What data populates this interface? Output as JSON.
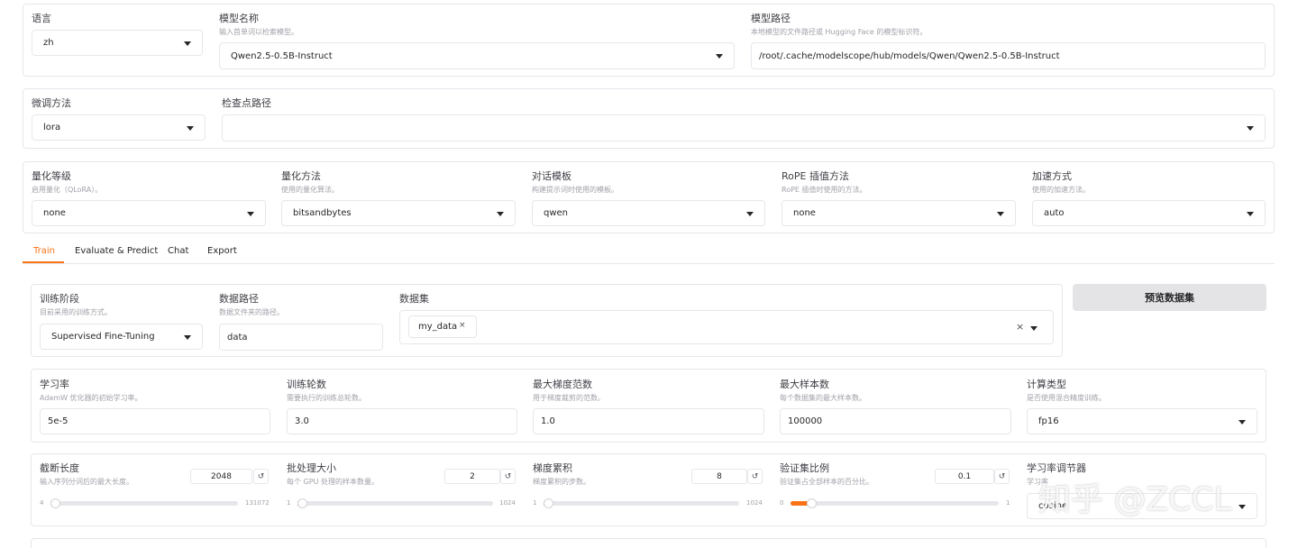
{
  "top": {
    "lang": {
      "label": "语言",
      "value": "zh"
    },
    "model_name": {
      "label": "模型名称",
      "info": "输入首单词以检索模型。",
      "value": "Qwen2.5-0.5B-Instruct"
    },
    "model_path": {
      "label": "模型路径",
      "info": "本地模型的文件路径或 Hugging Face 的模型标识符。",
      "value": "/root/.cache/modelscope/hub/models/Qwen/Qwen2.5-0.5B-Instruct"
    }
  },
  "finetune": {
    "method": {
      "label": "微调方法",
      "value": "lora"
    },
    "checkpoint": {
      "label": "检查点路径",
      "value": ""
    }
  },
  "advanced": {
    "quant_bit": {
      "label": "量化等级",
      "info": "启用量化（QLoRA）。",
      "value": "none"
    },
    "quant_method": {
      "label": "量化方法",
      "info": "使用的量化算法。",
      "value": "bitsandbytes"
    },
    "template": {
      "label": "对话模板",
      "info": "构建提示词时使用的模板。",
      "value": "qwen"
    },
    "rope": {
      "label": "RoPE 插值方法",
      "info": "RoPE 插值时使用的方法。",
      "value": "none"
    },
    "booster": {
      "label": "加速方式",
      "info": "使用的加速方法。",
      "value": "auto"
    }
  },
  "tabs": [
    "Train",
    "Evaluate & Predict",
    "Chat",
    "Export"
  ],
  "train": {
    "stage": {
      "label": "训练阶段",
      "info": "目前采用的训练方式。",
      "value": "Supervised Fine-Tuning"
    },
    "dataset_dir": {
      "label": "数据路径",
      "info": "数据文件夹的路径。",
      "value": "data"
    },
    "dataset": {
      "label": "数据集",
      "chip": "my_data"
    },
    "preview_button": "预览数据集",
    "lr": {
      "label": "学习率",
      "info": "AdamW 优化器的初始学习率。",
      "value": "5e-5"
    },
    "epochs": {
      "label": "训练轮数",
      "info": "需要执行的训练总轮数。",
      "value": "3.0"
    },
    "max_grad_norm": {
      "label": "最大梯度范数",
      "info": "用于梯度裁剪的范数。",
      "value": "1.0"
    },
    "max_samples": {
      "label": "最大样本数",
      "info": "每个数据集的最大样本数。",
      "value": "100000"
    },
    "compute_type": {
      "label": "计算类型",
      "info": "是否使用混合精度训练。",
      "value": "fp16"
    },
    "cutoff_len": {
      "label": "截断长度",
      "info": "输入序列分词后的最大长度。",
      "value": "2048",
      "min": "4",
      "max": "131072",
      "fraction": 0.016
    },
    "batch_size": {
      "label": "批处理大小",
      "info": "每个 GPU 处理的样本数量。",
      "value": "2",
      "min": "1",
      "max": "1024",
      "fraction": 0.001
    },
    "grad_accum": {
      "label": "梯度累积",
      "info": "梯度累积的步数。",
      "value": "8",
      "min": "1",
      "max": "1024",
      "fraction": 0.007
    },
    "val_size": {
      "label": "验证集比例",
      "info": "验证集占全部样本的百分比。",
      "value": "0.1",
      "min": "0",
      "max": "1",
      "fraction": 0.1
    },
    "lr_scheduler": {
      "label": "学习率调节器",
      "info": "学习率",
      "value": "cosine"
    },
    "reset_icon": "↺",
    "clear_icon": "×"
  },
  "watermark": "知乎 @ZCCL",
  "colors": {
    "accent": "#f97316",
    "border": "#e5e7eb"
  }
}
